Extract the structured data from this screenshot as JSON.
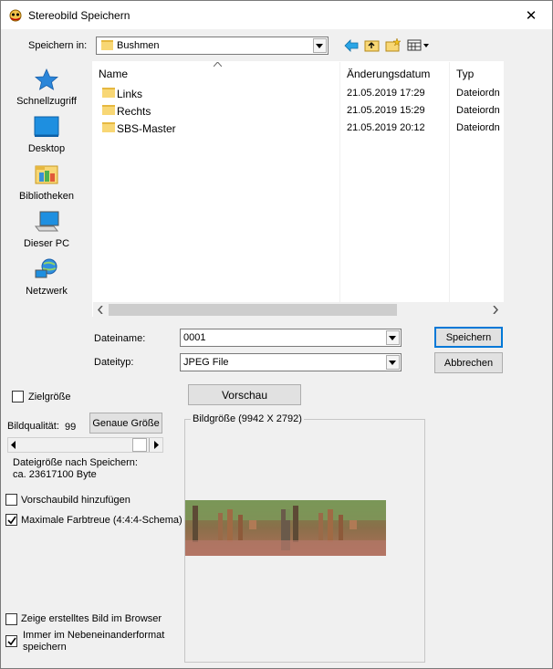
{
  "window": {
    "title": "Stereobild Speichern",
    "close_glyph": "✕"
  },
  "save_in": {
    "label": "Speichern in:",
    "value": "Bushmen"
  },
  "places": [
    {
      "label": "Schnellzugriff",
      "icon": "star-icon"
    },
    {
      "label": "Desktop",
      "icon": "desktop-icon"
    },
    {
      "label": "Bibliotheken",
      "icon": "libraries-icon"
    },
    {
      "label": "Dieser PC",
      "icon": "computer-icon"
    },
    {
      "label": "Netzwerk",
      "icon": "network-icon"
    }
  ],
  "columns": {
    "name": "Name",
    "date": "Änderungsdatum",
    "type": "Typ"
  },
  "files": [
    {
      "name": "Links",
      "date": "21.05.2019 17:29",
      "type": "Dateiordn"
    },
    {
      "name": "Rechts",
      "date": "21.05.2019 15:29",
      "type": "Dateiordn"
    },
    {
      "name": "SBS-Master",
      "date": "21.05.2019 20:12",
      "type": "Dateiordn"
    }
  ],
  "filename": {
    "label": "Dateiname:",
    "value": "0001"
  },
  "filetype": {
    "label": "Dateityp:",
    "value": "JPEG File"
  },
  "buttons": {
    "save": "Speichern",
    "cancel": "Abbrechen",
    "preview": "Vorschau",
    "exact_size": "Genaue Größe"
  },
  "options": {
    "target_size": {
      "label": "Zielgröße",
      "checked": false
    },
    "quality_label": "Bildqualität:",
    "quality_value": "99",
    "filesize_label": "Dateigröße nach Speichern:",
    "filesize_value": "ca. 23617100 Byte",
    "add_thumbnail": {
      "label": "Vorschaubild hinzufügen",
      "checked": false
    },
    "max_color": {
      "label": "Maximale Farbtreue (4:4:4-Schema)",
      "checked": true
    },
    "show_browser": {
      "label": "Zeige erstelltes Bild im Browser",
      "checked": false
    },
    "always_sbs": {
      "label": "Immer im Nebeneinanderformat speichern",
      "checked": true
    }
  },
  "image_size": {
    "label": "Bildgröße (9942 X 2792)"
  }
}
